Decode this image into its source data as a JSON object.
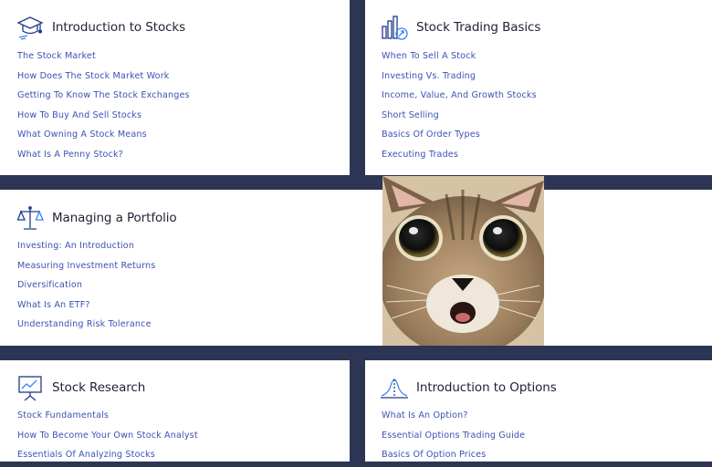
{
  "cards": [
    {
      "title": "Introduction to Stocks",
      "icon": "graduation-cap-icon",
      "links": [
        "The Stock Market",
        "How Does The Stock Market Work",
        "Getting To Know The Stock Exchanges",
        "How To Buy And Sell Stocks",
        "What Owning A Stock Means",
        "What Is A Penny Stock?"
      ]
    },
    {
      "title": "Stock Trading Basics",
      "icon": "bar-chart-icon",
      "links": [
        "When To Sell A Stock",
        "Investing Vs. Trading",
        "Income, Value, And Growth Stocks",
        "Short Selling",
        "Basics Of Order Types",
        "Executing Trades"
      ]
    },
    {
      "title": "Managing a Portfolio",
      "icon": "balance-scale-icon",
      "links": [
        "Investing: An Introduction",
        "Measuring Investment Returns",
        "Diversification",
        "What Is An ETF?",
        "Understanding Risk Tolerance"
      ]
    },
    {
      "title": "Stock Research",
      "icon": "presentation-board-icon",
      "links": [
        "Stock Fundamentals",
        "How To Become Your Own Stock Analyst",
        "Essentials Of Analyzing Stocks"
      ]
    },
    {
      "title": "Introduction to Options",
      "icon": "line-graph-icon",
      "links": [
        "What Is An Option?",
        "Essential Options Trading Guide",
        "Basics Of Option Prices"
      ]
    }
  ],
  "image": {
    "subject": "surprised cat photo"
  },
  "colors": {
    "background": "#2c3554",
    "link": "#3b52b4",
    "icon": "#1f3a8a",
    "heading": "#1d2233"
  }
}
